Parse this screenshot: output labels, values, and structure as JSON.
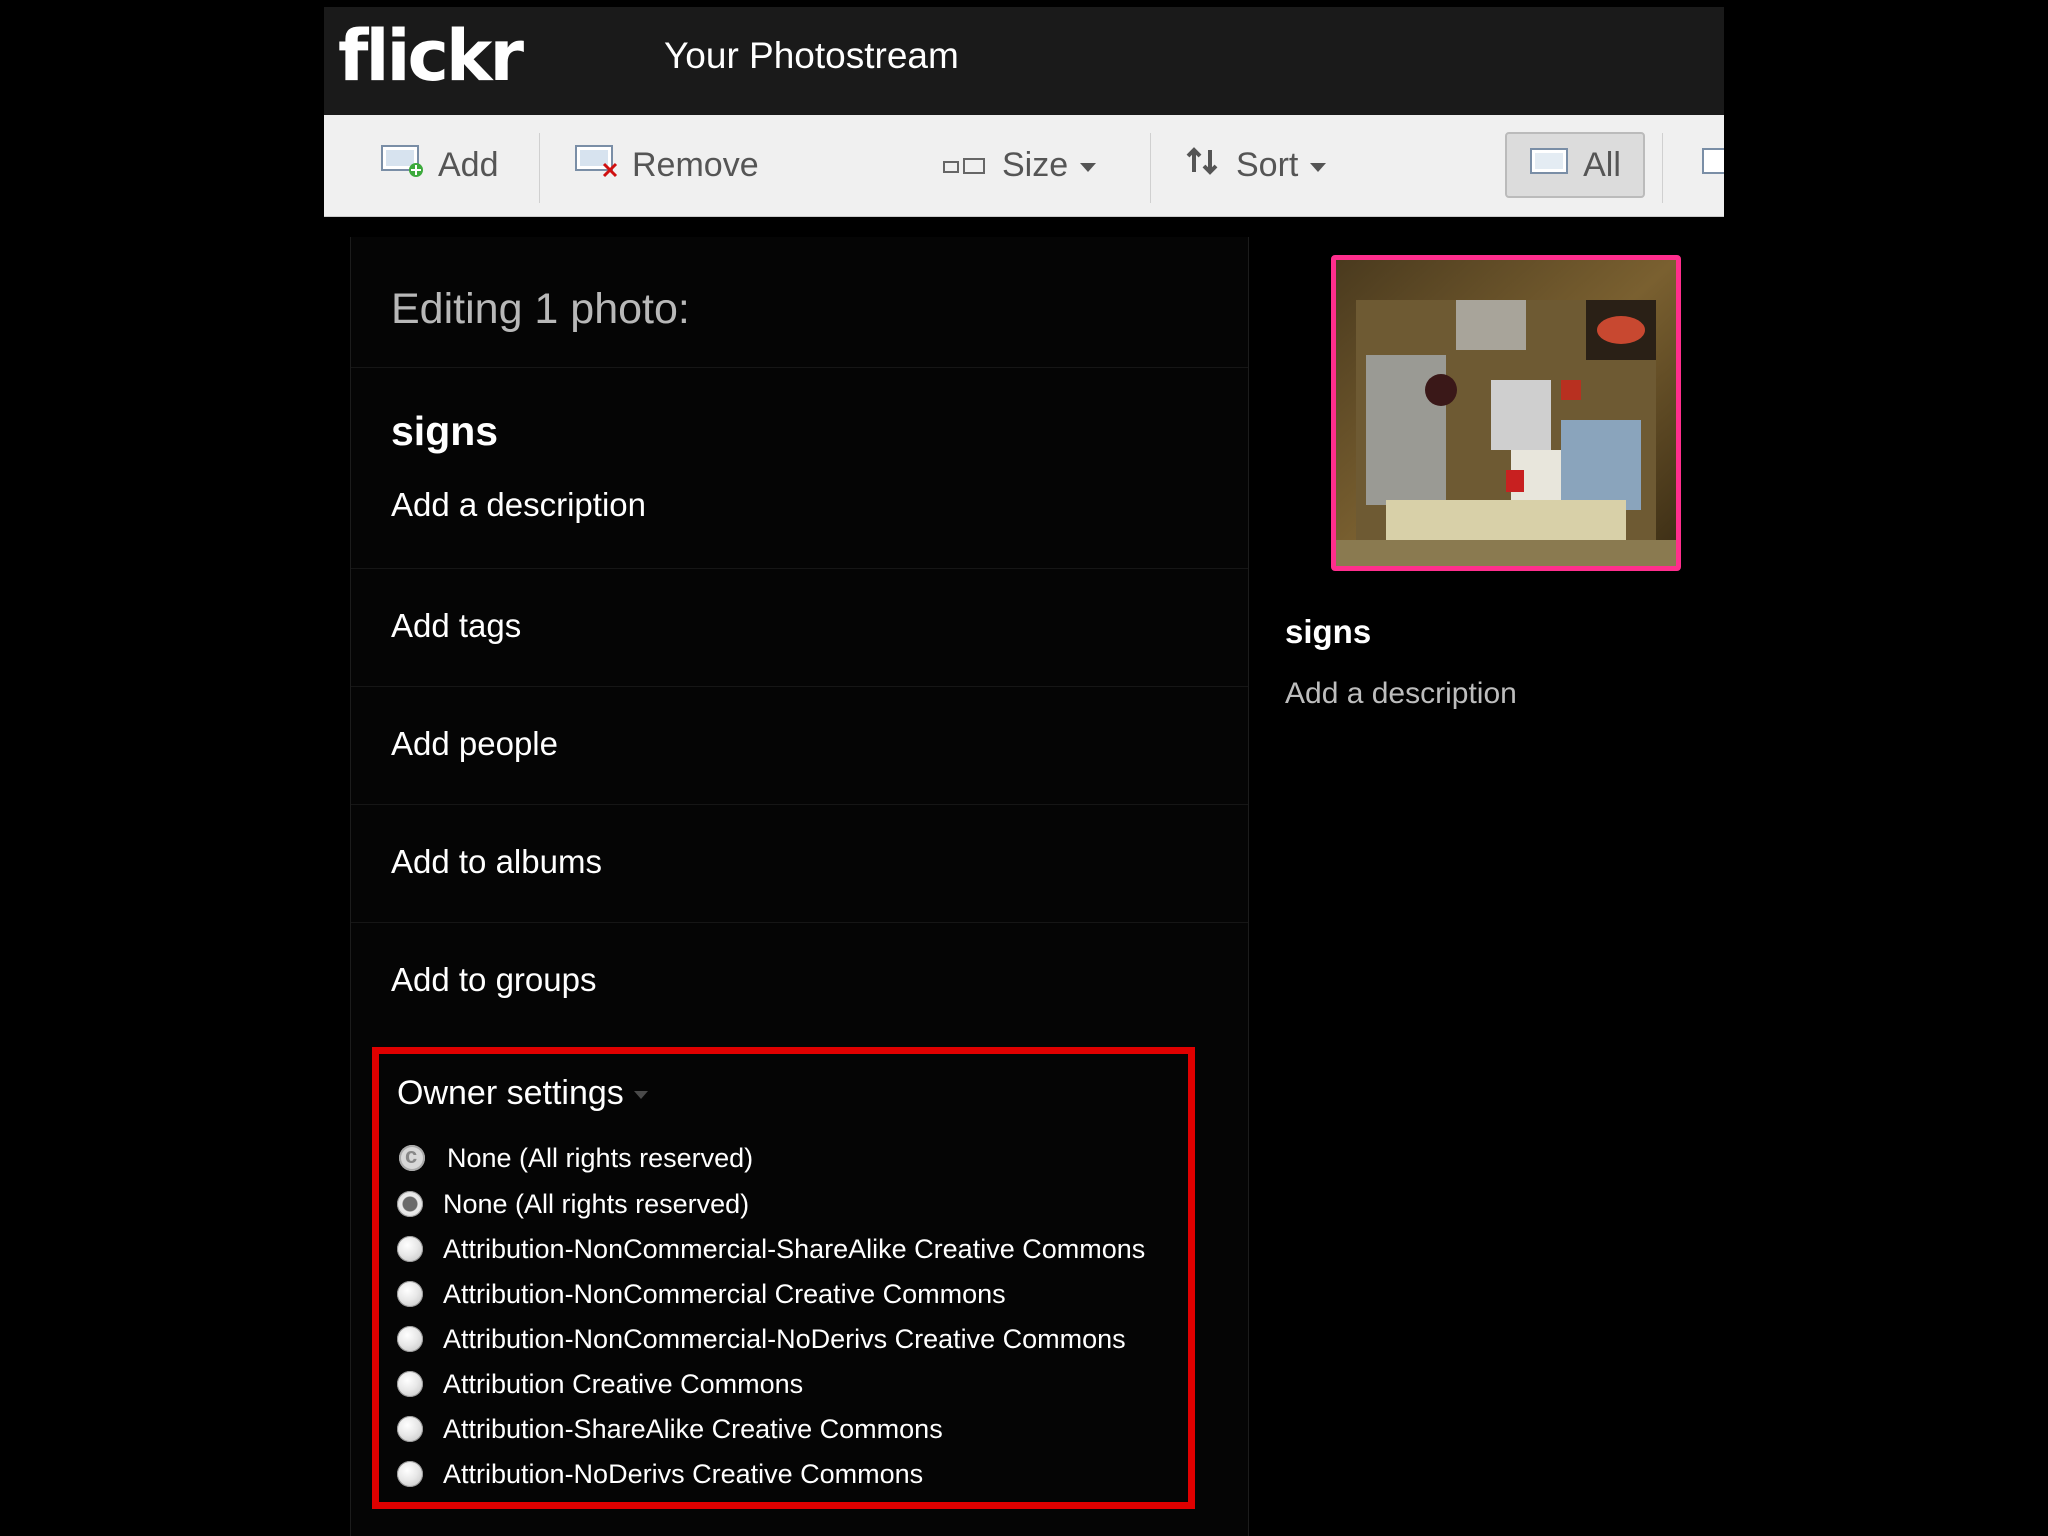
{
  "header": {
    "logo": "flickr",
    "page_title": "Your Photostream"
  },
  "toolbar": {
    "add": "Add",
    "remove": "Remove",
    "size": "Size",
    "sort": "Sort",
    "all": "All"
  },
  "editor": {
    "heading": "Editing 1 photo:",
    "photo_title": "signs",
    "add_description": "Add a description",
    "rows": [
      "Add tags",
      "Add people",
      "Add to albums",
      "Add to groups"
    ]
  },
  "owner_settings": {
    "title": "Owner settings",
    "current": "None (All rights reserved)",
    "options": [
      "None (All rights reserved)",
      "Attribution-NonCommercial-ShareAlike Creative Commons",
      "Attribution-NonCommercial Creative Commons",
      "Attribution-NonCommercial-NoDerivs Creative Commons",
      "Attribution Creative Commons",
      "Attribution-ShareAlike Creative Commons",
      "Attribution-NoDerivs Creative Commons"
    ],
    "selected_index": 0
  },
  "preview": {
    "title": "signs",
    "description": "Add a description"
  },
  "colors": {
    "highlight_box": "#e00000",
    "selected_thumb": "#ff2e8d"
  }
}
